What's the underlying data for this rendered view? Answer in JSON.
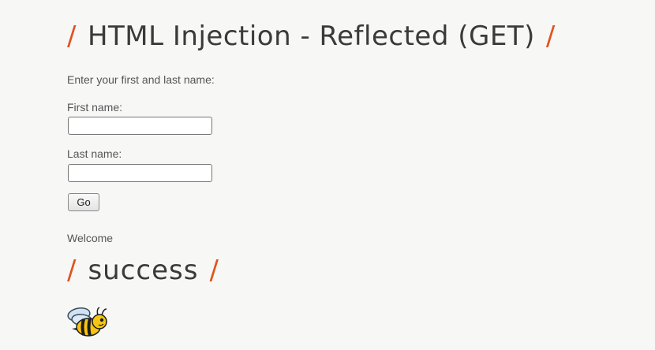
{
  "header": {
    "title": "HTML Injection - Reflected (GET)",
    "slash": "/"
  },
  "form": {
    "intro": "Enter your first and last name:",
    "first_name_label": "First name:",
    "first_name_value": "",
    "last_name_label": "Last name:",
    "last_name_value": "",
    "submit_label": "Go"
  },
  "result": {
    "welcome_text": "Welcome",
    "injected_heading": "success",
    "slash": "/"
  },
  "colors": {
    "accent": "#e0531f",
    "heading": "#3a3a3a",
    "background": "#f7f7f6"
  },
  "icons": {
    "logo": "bee-icon"
  }
}
